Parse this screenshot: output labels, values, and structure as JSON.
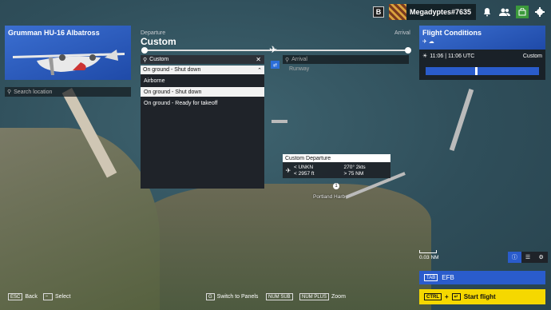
{
  "topbar": {
    "badge": "B",
    "username": "Megadyptes#7635"
  },
  "aircraft": {
    "name": "Grumman HU-16 Albatross"
  },
  "search_location": {
    "placeholder": "Search location"
  },
  "departure": {
    "label": "Departure",
    "title": "Custom",
    "search_value": "Custom",
    "state_selected": "On ground - Shut down",
    "options": [
      "Airborne",
      "On ground - Shut down",
      "On ground - Ready for takeoff"
    ]
  },
  "arrival": {
    "label": "Arrival",
    "search_placeholder": "Arrival",
    "runway": "Runway"
  },
  "conditions": {
    "title": "Flight Conditions",
    "time": "11:06 | 11:06 UTC",
    "preset": "Custom"
  },
  "map_tooltip": {
    "title": "Custom Departure",
    "altitude": "< UNKN",
    "wind": "270° 2kts",
    "ceiling": "< 2957 ft",
    "visibility": "> 75 NM"
  },
  "map_labels": {
    "portland": "Portland Harb",
    "pin": "1"
  },
  "scale": "0.03 NM",
  "efb": {
    "key": "TAB",
    "label": "EFB"
  },
  "start_flight": {
    "key": "CTRL",
    "label": "Start flight"
  },
  "hints": {
    "back_key": "ESC",
    "back": "Back",
    "select": "Select",
    "switch_key": "G",
    "switch": "Switch to Panels",
    "zoom_out_key": "NUM SUB",
    "zoom_in_key": "NUM PLUS",
    "zoom": "Zoom"
  }
}
